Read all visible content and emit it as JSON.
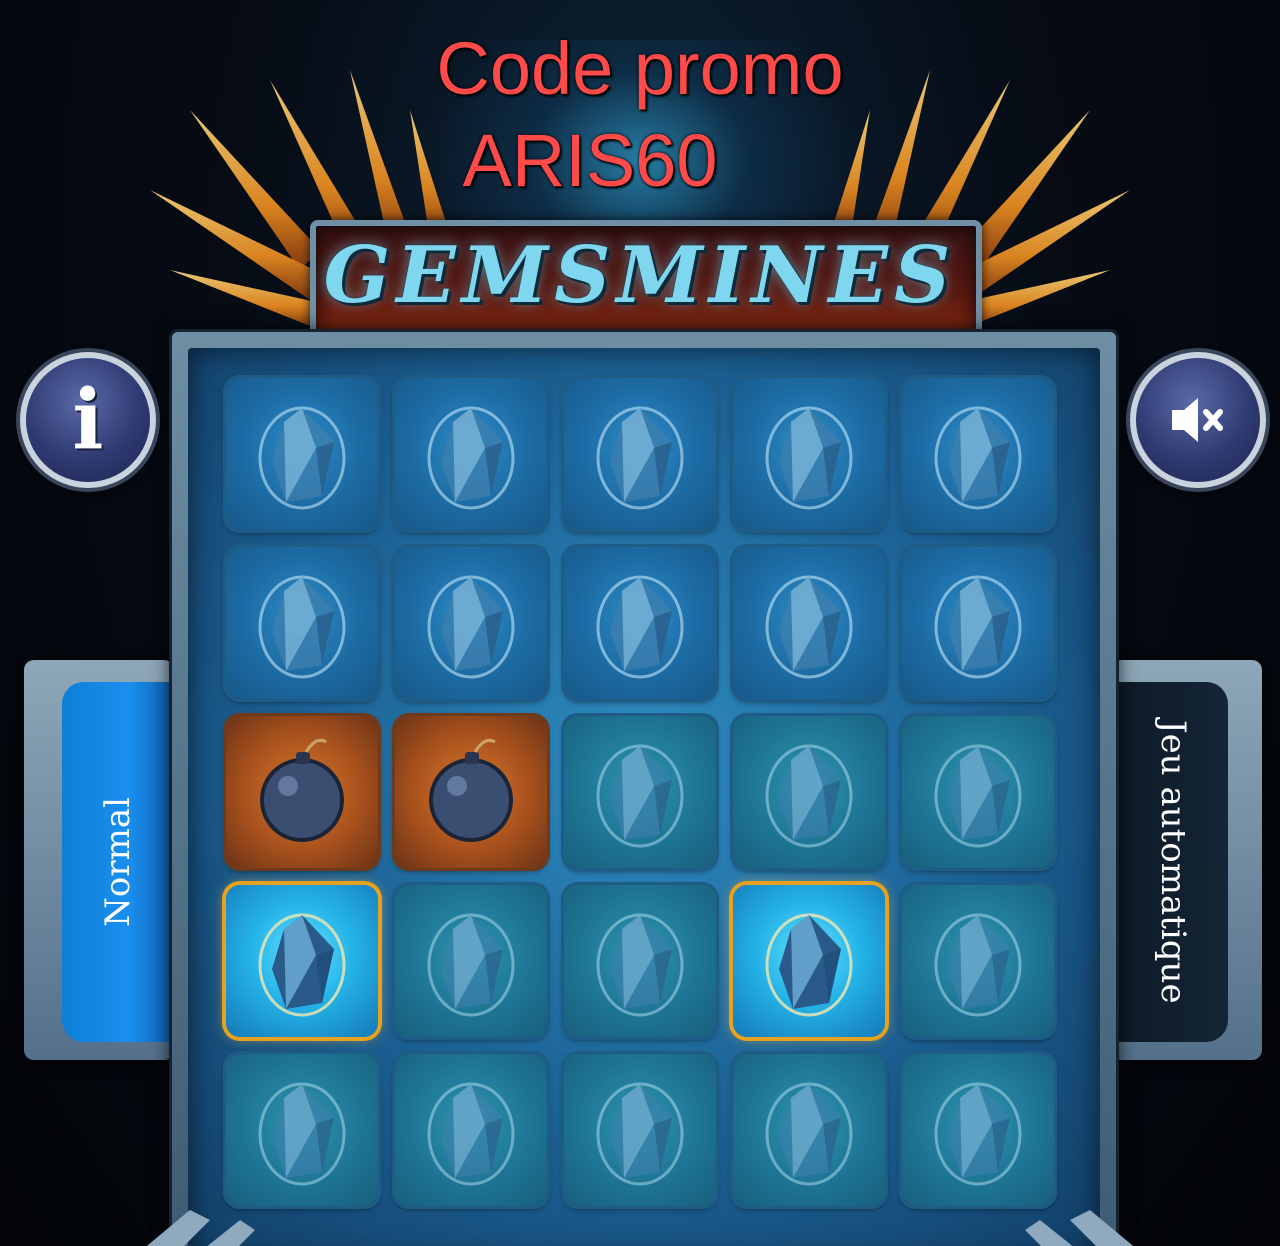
{
  "overlay": {
    "promo_line1": "Code promo",
    "promo_line2": "ARIS60",
    "promo_color": "#ff4a4a"
  },
  "header": {
    "title": "GemsMines"
  },
  "controls": {
    "info_label": "i",
    "info_icon": "info-icon",
    "sound_icon": "speaker-muted-icon"
  },
  "mode_tabs": {
    "left": {
      "label": "Normal",
      "active": true
    },
    "right": {
      "label": "Jeu automatique",
      "active": false
    }
  },
  "board": {
    "rows": 5,
    "cols": 5,
    "cells": [
      [
        "hidden",
        "hidden",
        "hidden",
        "hidden",
        "hidden"
      ],
      [
        "hidden",
        "hidden",
        "hidden",
        "hidden",
        "hidden"
      ],
      [
        "bomb",
        "bomb",
        "teal",
        "teal",
        "teal"
      ],
      [
        "gem",
        "teal",
        "teal",
        "gem",
        "teal"
      ],
      [
        "teal",
        "teal",
        "teal",
        "teal",
        "teal"
      ]
    ],
    "colors": {
      "gem_highlight": "#e6a21f",
      "bomb_tile": "#a8511d",
      "hidden_tile": "#1c6aa2"
    }
  }
}
